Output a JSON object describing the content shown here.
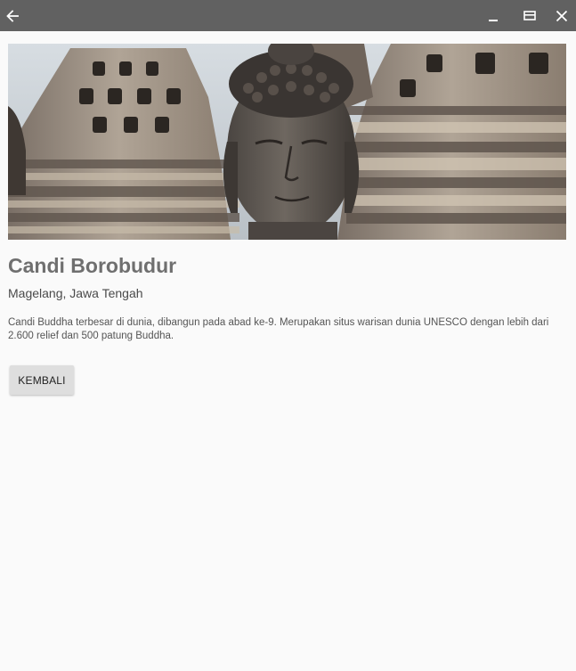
{
  "window": {
    "back_icon": "arrow-left-icon",
    "minimize_icon": "minimize-icon",
    "maximize_icon": "maximize-icon",
    "close_icon": "close-icon",
    "titlebar_color": "#616161"
  },
  "hero": {
    "image_description": "stone Buddha head in front of stupas"
  },
  "detail": {
    "title": "Candi Borobudur",
    "location": "Magelang, Jawa Tengah",
    "description": "Candi Buddha terbesar di dunia, dibangun pada abad ke-9. Merupakan situs warisan dunia UNESCO dengan lebih dari 2.600 relief dan 500 patung Buddha.",
    "back_button_label": "KEMBALI"
  }
}
